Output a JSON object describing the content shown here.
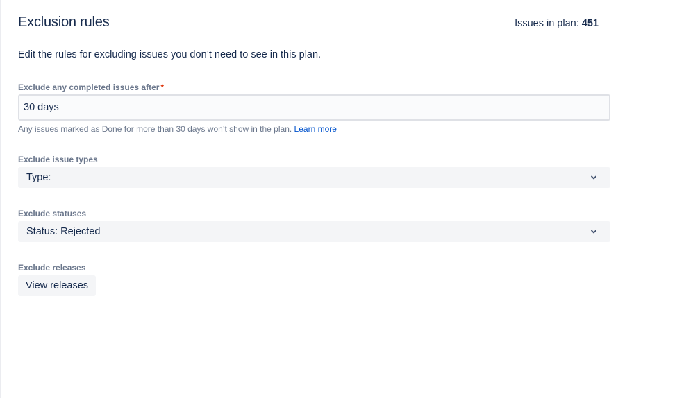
{
  "header": {
    "title": "Exclusion rules",
    "issues_label": "Issues in plan: ",
    "issues_count": "451"
  },
  "description": "Edit the rules for excluding issues you don’t need to see in this plan.",
  "completed_field": {
    "label": "Exclude any completed issues after",
    "required_mark": "*",
    "value": "30 days",
    "helper_text": "Any issues marked as Done for more than 30 days won’t show in the plan. ",
    "helper_link": "Learn more"
  },
  "issue_types_field": {
    "label": "Exclude issue types",
    "value": "Type:"
  },
  "statuses_field": {
    "label": "Exclude statuses",
    "value": "Status: Rejected"
  },
  "releases_field": {
    "label": "Exclude releases",
    "button_label": "View releases"
  },
  "icons": {
    "select_chevron": "chevron-down-icon"
  }
}
